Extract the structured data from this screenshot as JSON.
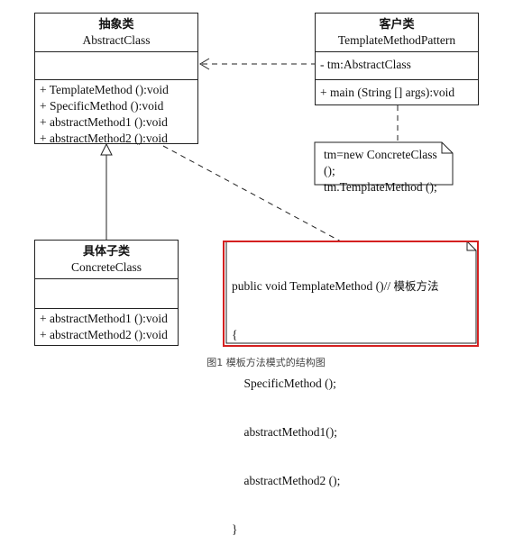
{
  "abstract_class": {
    "name_cn": "抽象类",
    "name_en": "AbstractClass",
    "operations": [
      "+ TemplateMethod ():void",
      "+ SpecificMethod ():void",
      "+ abstractMethod1 ():void",
      "+ abstractMethod2 ():void"
    ]
  },
  "client_class": {
    "name_cn": "客户类",
    "name_en": "TemplateMethodPattern",
    "attributes": [
      "- tm:AbstractClass"
    ],
    "operations": [
      "+ main (String [] args):void"
    ]
  },
  "concrete_class": {
    "name_cn": "具体子类",
    "name_en": "ConcreteClass",
    "operations": [
      "+ abstractMethod1 ():void",
      "+ abstractMethod2 ():void"
    ]
  },
  "client_note": {
    "lines": [
      "tm=new ConcreteClass ();",
      "tm.TemplateMethod ();"
    ]
  },
  "template_note": {
    "signature": "public void TemplateMethod ()// ",
    "comment": "模板方法",
    "lines": [
      "{",
      "    SpecificMethod ();",
      "    abstractMethod1();",
      "    abstractMethod2 ();",
      "}"
    ],
    "highlight_color": "#d42020"
  },
  "caption": "图1 模板方法模式的结构图"
}
